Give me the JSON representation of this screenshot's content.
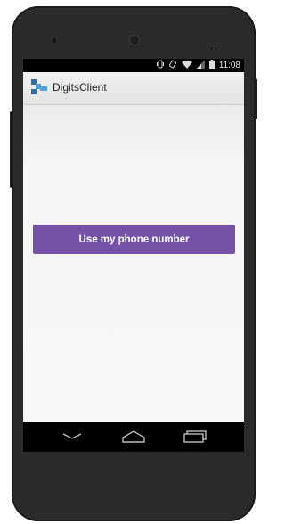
{
  "status_bar": {
    "time": "11:08",
    "icons": [
      "vibrate-icon",
      "rotation-icon",
      "wifi-icon",
      "signal-icon",
      "battery-icon"
    ]
  },
  "app_bar": {
    "title": "DigitsClient",
    "logo_icon": "digits-logo-icon",
    "logo_color": "#4da3d9"
  },
  "main": {
    "primary_button_label": "Use my phone number",
    "primary_button_color": "#7452a7"
  },
  "nav_bar": {
    "items": [
      "back-icon",
      "home-icon",
      "recents-icon"
    ]
  }
}
